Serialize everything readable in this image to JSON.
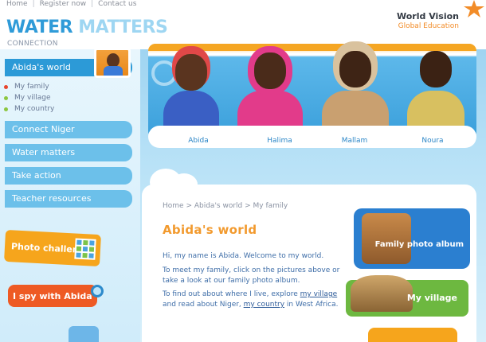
{
  "topnav": {
    "home": "Home",
    "register": "Register now",
    "contact": "Contact us",
    "sep": "|"
  },
  "logo": {
    "water": "WATER",
    "matters": "MATTERS",
    "sub": "CONNECTION"
  },
  "partner": {
    "line1": "World Vision",
    "line2": "Global Education"
  },
  "sidebar": {
    "items": [
      {
        "label": "Abida's world"
      },
      {
        "label": "Connect Niger"
      },
      {
        "label": "Water matters"
      },
      {
        "label": "Take action"
      },
      {
        "label": "Teacher resources"
      }
    ],
    "subitems": [
      {
        "label": "My family",
        "dot": "#e8452c"
      },
      {
        "label": "My village",
        "dot": "#8cc63f"
      },
      {
        "label": "My country",
        "dot": "#8cc63f"
      }
    ],
    "promos": {
      "photo": "Photo challenge",
      "ispy": "I spy with Abida"
    }
  },
  "banner": {
    "people": [
      {
        "name": "Abida"
      },
      {
        "name": "Halima"
      },
      {
        "name": "Mallam"
      },
      {
        "name": "Noura"
      }
    ]
  },
  "content": {
    "breadcrumb": "Home > Abida's world > My family",
    "title": "Abida's world",
    "p1": "Hi, my name is Abida. Welcome to my world.",
    "p2": "To meet my family, click on the pictures above or take a look at our family photo album.",
    "p3a": "To find out about where I live, explore ",
    "p3link1": "my village",
    "p3b": " and read about Niger, ",
    "p3link2": "my country",
    "p3c": " in West Africa."
  },
  "cards": {
    "album": "Family photo album",
    "village": "My village"
  },
  "colors": {
    "accent": "#2c9ad7",
    "orange": "#f29a2e",
    "green": "#6db840"
  }
}
